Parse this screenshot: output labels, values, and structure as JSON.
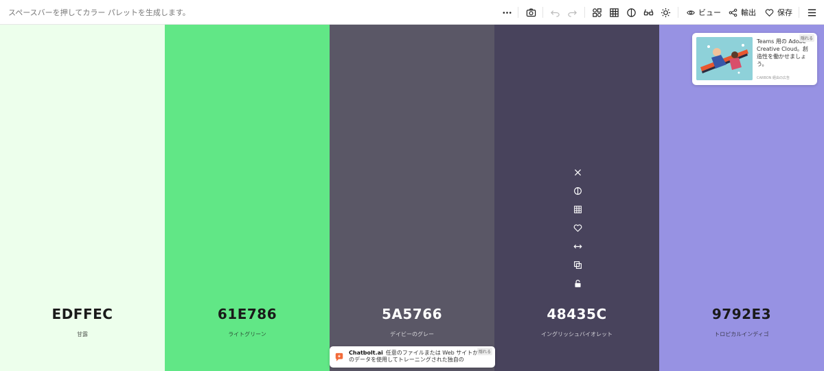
{
  "toolbar": {
    "hint": "スペースバーを押してカラー パレットを生成します。",
    "view_label": "ビュー",
    "export_label": "輸出",
    "save_label": "保存"
  },
  "palette": [
    {
      "hex": "EDFFEC",
      "name": "甘露",
      "color": "#EDFFEC",
      "text_color": "#1a1a1a"
    },
    {
      "hex": "61E786",
      "name": "ライトグリーン",
      "color": "#61E786",
      "text_color": "#1a1a1a"
    },
    {
      "hex": "5A5766",
      "name": "デイビーのグレー",
      "color": "#5A5766",
      "text_color": "#ffffff"
    },
    {
      "hex": "48435C",
      "name": "イングリッシュバイオレット",
      "color": "#48435C",
      "text_color": "#ffffff"
    },
    {
      "hex": "9792E3",
      "name": "トロピカルインディゴ",
      "color": "#9792E3",
      "text_color": "#1a1a1a"
    }
  ],
  "swatch_tools": [
    "close-icon",
    "contrast-icon",
    "shades-grid-icon",
    "heart-icon",
    "drag-arrows-icon",
    "copy-icon",
    "unlock-icon"
  ],
  "ad": {
    "text": "Teams 用の Adobe Creative Cloud。創造性を働かせましょう。",
    "footer": "CARBON 経由の広告",
    "close_label": "隠れる"
  },
  "chatbolt": {
    "brand": "Chatbolt.ai",
    "text": "任意のファイルまたは Web サイトからのデータを使用してトレーニングされた独自の",
    "close_label": "隠れる"
  }
}
